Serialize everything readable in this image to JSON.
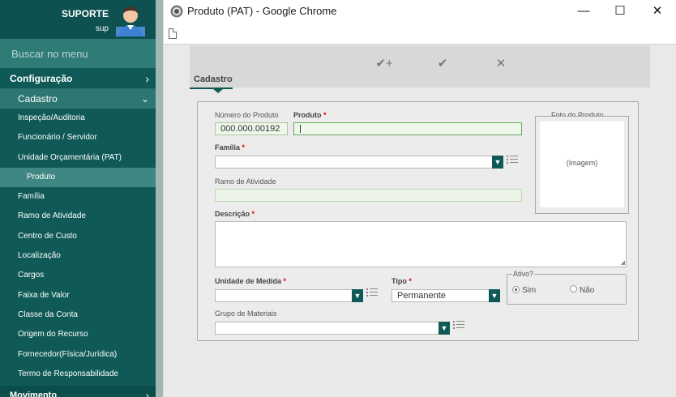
{
  "sidebar": {
    "user": {
      "name": "SUPORTE",
      "login": "sup"
    },
    "search_placeholder": "Buscar no menu",
    "top_menu": {
      "label": "Configuração",
      "icon": "chevron-right-icon"
    },
    "sub_menu": {
      "label": "Cadastro",
      "icon": "chevron-down-icon"
    },
    "items": [
      {
        "label": "Inspeção/Auditoria"
      },
      {
        "label": "Funcionário / Servidor"
      },
      {
        "label": "Unidade Orçamentária (PAT)"
      },
      {
        "label": "Produto",
        "selected": true
      },
      {
        "label": "Família"
      },
      {
        "label": "Ramo de Atividade"
      },
      {
        "label": "Centro de Custo"
      },
      {
        "label": "Localização"
      },
      {
        "label": "Cargos"
      },
      {
        "label": "Faixa de Valor"
      },
      {
        "label": "Classe da Conta"
      },
      {
        "label": "Origem do Recurso"
      },
      {
        "label": "Fornecedor(Física/Jurídica)"
      },
      {
        "label": "Termo de Responsabilidade"
      }
    ],
    "bottom_menu": {
      "label": "Movimento",
      "icon": "chevron-right-icon"
    }
  },
  "window": {
    "title": "Produto (PAT) - Google Chrome",
    "controls": {
      "minimize": "—",
      "maximize": "☐",
      "close": "✕"
    }
  },
  "toolbar": {
    "save_new": "✔+",
    "save": "✔",
    "cancel": "✕"
  },
  "tabs": [
    {
      "label": "Cadastro",
      "active": true
    }
  ],
  "form": {
    "numero_label": "Número do Produto",
    "numero_value": "000.000.00192",
    "produto_label": "Produto",
    "produto_value": "",
    "familia_label": "Família",
    "familia_value": "",
    "ramo_label": "Ramo de Atividade",
    "ramo_value": "",
    "descricao_label": "Descrição",
    "descricao_value": "",
    "unidade_label": "Unidade de Medida",
    "unidade_value": "",
    "tipo_label": "Tipo",
    "tipo_value": "Permanente",
    "ativo_legend": "Ativo?",
    "ativo_options": [
      {
        "label": "Sim",
        "checked": true
      },
      {
        "label": "Não",
        "checked": false
      }
    ],
    "grupo_label": "Grupo de Materiais",
    "grupo_value": "",
    "foto_label": "Foto do Produto",
    "foto_placeholder": "(Imagem)",
    "required_mark": "*"
  },
  "colors": {
    "sidebar_bg": "#0f5a57",
    "accent": "#0f5a57",
    "required": "#dd0000"
  }
}
